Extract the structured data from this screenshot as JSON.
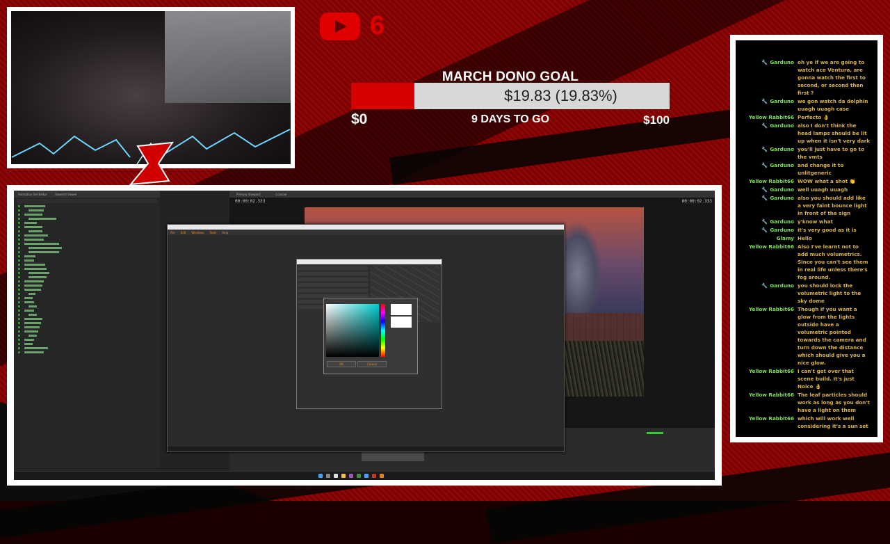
{
  "youtube": {
    "subscriber_count": "6"
  },
  "goal": {
    "title": "MARCH DONO GOAL",
    "amount_label": "$19.83 (19.83%)",
    "progress_percent": 19.83,
    "min_label": "$0",
    "days_label": "9 DAYS TO GO",
    "max_label": "$100"
  },
  "chat": {
    "messages": [
      {
        "user": "Garduno",
        "wrench": true,
        "text": "oh ye if we are going to watch ace Ventura, are gonna watch the first to second, or second then first ?"
      },
      {
        "user": "Garduno",
        "wrench": true,
        "text": "we gon watch da dolphin uuagh uuagh case"
      },
      {
        "user": "Yellow Rabbit66",
        "wrench": false,
        "text": "Perfecto 👌"
      },
      {
        "user": "Garduno",
        "wrench": true,
        "text": "also I don't think the head lamps should be lit up when it isn't very dark"
      },
      {
        "user": "Garduno",
        "wrench": true,
        "text": "you'll just have to go to the vmts"
      },
      {
        "user": "Garduno",
        "wrench": true,
        "text": "and change it to unlitgeneric"
      },
      {
        "user": "Yellow Rabbit66",
        "wrench": false,
        "text": "WOW what a shot 👏"
      },
      {
        "user": "Garduno",
        "wrench": true,
        "text": "well uuagh uuagh"
      },
      {
        "user": "Garduno",
        "wrench": true,
        "text": "also you should add like a very faint bounce light in front of the sign"
      },
      {
        "user": "Garduno",
        "wrench": true,
        "text": "y'know what"
      },
      {
        "user": "Garduno",
        "wrench": true,
        "text": "it's very good as it is"
      },
      {
        "user": "Glamy",
        "wrench": false,
        "text": "Hello"
      },
      {
        "user": "Yellow Rabbit66",
        "wrench": false,
        "text": "Also I've learnt not to add much volumetrics. Since you can't see them in real life unless there's fog around."
      },
      {
        "user": "Garduno",
        "wrench": true,
        "text": "you should lock the volumetric light to the sky dome"
      },
      {
        "user": "Yellow Rabbit66",
        "wrench": false,
        "text": "Though if you want a glow from the lights outside have a volumetric pointed towards the camera and turn down the distance which should give you a nice glow."
      },
      {
        "user": "Yellow Rabbit66",
        "wrench": false,
        "text": "I can't get over that scene build. It's just Noice 👌"
      },
      {
        "user": "Yellow Rabbit66",
        "wrench": false,
        "text": "The leaf particles should work as long as you don't have a light on them"
      },
      {
        "user": "Yellow Rabbit66",
        "wrench": false,
        "text": "which will work well considering it's a sun set"
      }
    ]
  },
  "editor": {
    "outliner_tabs": [
      "Animation Set Editor",
      "Element Viewer"
    ],
    "viewport_tabs": [
      "Primary Viewport",
      "Console"
    ],
    "timecode_left": "00:00:02.333",
    "timecode_right": "00:00:02.333",
    "menu": [
      "File",
      "Edit",
      "Windows",
      "Tools",
      "Help"
    ],
    "picker_ok": "OK",
    "picker_cancel": "Cancel"
  },
  "colors": {
    "accent_red": "#d60000",
    "youtube_red": "#e00000",
    "chat_user_green": "#7fe05a",
    "chat_text_gold": "#d9b24a"
  }
}
